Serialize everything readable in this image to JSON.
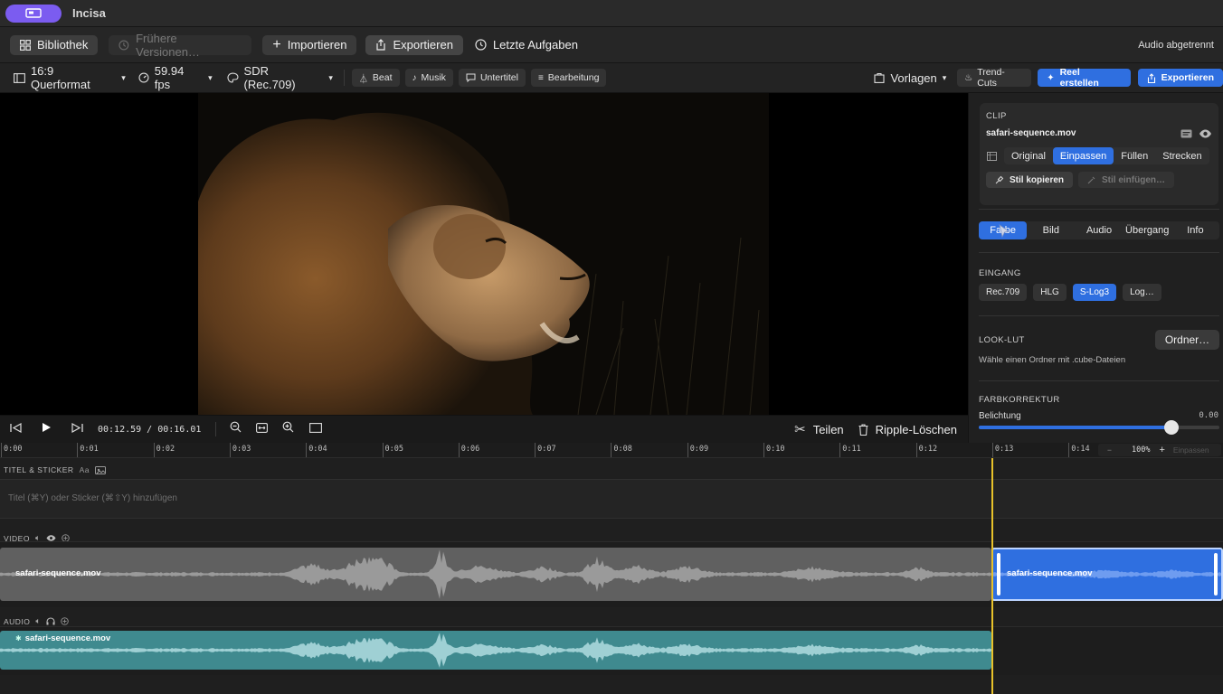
{
  "app": {
    "title": "Incisa"
  },
  "toolbar": {
    "library": "Bibliothek",
    "versions": "Frühere Versionen…",
    "import": "Importieren",
    "export": "Exportieren",
    "recent": "Letzte Aufgaben",
    "status": "Audio abgetrennt"
  },
  "toolbar2": {
    "aspect": "16:9 Querformat",
    "fps": "59.94 fps",
    "color": "SDR (Rec.709)",
    "beat": "Beat",
    "music": "Musik",
    "subtitles": "Untertitel",
    "edit": "Bearbeitung",
    "templates": "Vorlagen",
    "trend": "Trend-Cuts",
    "reel": "Reel erstellen",
    "export": "Exportieren"
  },
  "transport": {
    "timecode": "00:12.59 / 00:16.01",
    "split": "Teilen",
    "ripple": "Ripple-Löschen"
  },
  "inspector": {
    "clip_label": "CLIP",
    "filename": "safari-sequence.mov",
    "fit_modes": [
      "Original",
      "Einpassen",
      "Füllen",
      "Strecken"
    ],
    "fit_selected": 1,
    "copy_style": "Stil kopieren",
    "paste_style": "Stil einfügen…",
    "tabs": [
      "Farbe",
      "Bild",
      "Audio",
      "Übergang",
      "Info"
    ],
    "tab_selected": 0,
    "input_label": "EINGANG",
    "inputs": [
      "Rec.709",
      "HLG",
      "S-Log3",
      "Log…"
    ],
    "input_selected": 2,
    "lut_label": "LOOK-LUT",
    "lut_button": "Ordner…",
    "lut_hint": "Wähle einen Ordner mit .cube-Dateien",
    "cc_label": "FARBKORREKTUR",
    "exposure_label": "Belichtung",
    "exposure_value": "0.00",
    "exposure_level": 0.8
  },
  "timeline": {
    "ticks": [
      "0:00",
      "0:01",
      "0:02",
      "0:03",
      "0:04",
      "0:05",
      "0:06",
      "0:07",
      "0:08",
      "0:09",
      "0:10",
      "0:11",
      "0:12",
      "0:13",
      "0:14"
    ],
    "zoom": "100%",
    "zoom_fit": "Einpassen",
    "title_track_label": "TITEL & STICKER",
    "title_track_aa": "Aa",
    "title_placeholder": "Titel (⌘Y) oder Sticker (⌘⇧Y) hinzufügen",
    "video_track_label": "VIDEO",
    "audio_track_label": "AUDIO",
    "video_clip_a": "safari-sequence.mov",
    "video_clip_b": "safari-sequence.mov",
    "audio_clip": "safari-sequence.mov"
  },
  "colors": {
    "accent": "#2f6fe0",
    "playhead": "#e8c22a",
    "audio_clip": "#3f8a8f",
    "app_pill": "#7b5cf0"
  }
}
